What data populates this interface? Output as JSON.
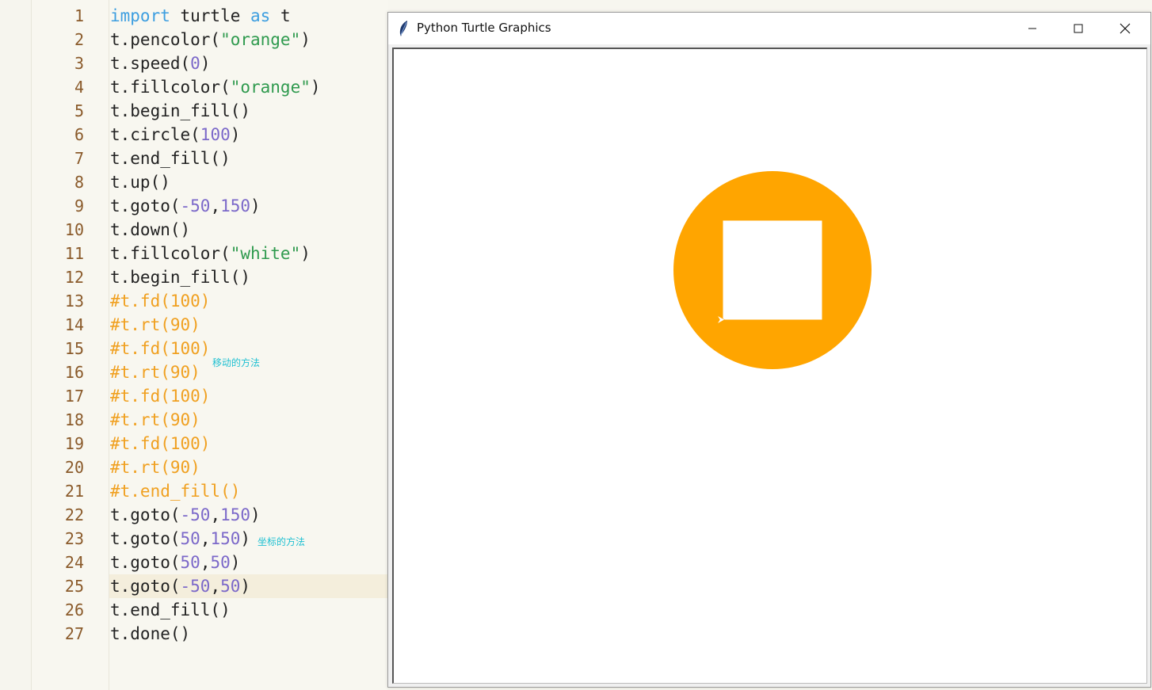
{
  "editor": {
    "lines": [
      {
        "n": "1",
        "tokens": [
          [
            "kw",
            "import"
          ],
          [
            "t",
            " turtle "
          ],
          [
            "kw",
            "as"
          ],
          [
            "t",
            " t"
          ]
        ]
      },
      {
        "n": "2",
        "tokens": [
          [
            "t",
            "t.pencolor("
          ],
          [
            "str",
            "\"orange\""
          ],
          [
            "t",
            ")"
          ]
        ]
      },
      {
        "n": "3",
        "tokens": [
          [
            "t",
            "t.speed("
          ],
          [
            "num",
            "0"
          ],
          [
            "t",
            ")"
          ]
        ]
      },
      {
        "n": "4",
        "tokens": [
          [
            "t",
            "t.fillcolor("
          ],
          [
            "str",
            "\"orange\""
          ],
          [
            "t",
            ")"
          ]
        ]
      },
      {
        "n": "5",
        "tokens": [
          [
            "t",
            "t.begin_fill()"
          ]
        ]
      },
      {
        "n": "6",
        "tokens": [
          [
            "t",
            "t.circle("
          ],
          [
            "num",
            "100"
          ],
          [
            "t",
            ")"
          ]
        ]
      },
      {
        "n": "7",
        "tokens": [
          [
            "t",
            "t.end_fill()"
          ]
        ]
      },
      {
        "n": "8",
        "tokens": [
          [
            "t",
            "t.up()"
          ]
        ]
      },
      {
        "n": "9",
        "tokens": [
          [
            "t",
            "t.goto("
          ],
          [
            "num",
            "-50"
          ],
          [
            "t",
            ","
          ],
          [
            "num",
            "150"
          ],
          [
            "t",
            ")"
          ]
        ]
      },
      {
        "n": "10",
        "tokens": [
          [
            "t",
            "t.down()"
          ]
        ]
      },
      {
        "n": "11",
        "tokens": [
          [
            "t",
            "t.fillcolor("
          ],
          [
            "str",
            "\"white\""
          ],
          [
            "t",
            ")"
          ]
        ]
      },
      {
        "n": "12",
        "tokens": [
          [
            "t",
            "t.begin_fill()"
          ]
        ]
      },
      {
        "n": "13",
        "tokens": [
          [
            "cmt",
            "#t.fd(100)"
          ]
        ]
      },
      {
        "n": "14",
        "tokens": [
          [
            "cmt",
            "#t.rt(90)"
          ]
        ]
      },
      {
        "n": "15",
        "tokens": [
          [
            "cmt",
            "#t.fd(100)"
          ]
        ]
      },
      {
        "n": "16",
        "tokens": [
          [
            "cmt",
            "#t.rt(90)"
          ]
        ]
      },
      {
        "n": "17",
        "tokens": [
          [
            "cmt",
            "#t.fd(100)"
          ]
        ]
      },
      {
        "n": "18",
        "tokens": [
          [
            "cmt",
            "#t.rt(90)"
          ]
        ]
      },
      {
        "n": "19",
        "tokens": [
          [
            "cmt",
            "#t.fd(100)"
          ]
        ]
      },
      {
        "n": "20",
        "tokens": [
          [
            "cmt",
            "#t.rt(90)"
          ]
        ]
      },
      {
        "n": "21",
        "tokens": [
          [
            "cmt",
            "#t.end_fill()"
          ]
        ]
      },
      {
        "n": "22",
        "tokens": [
          [
            "t",
            "t.goto("
          ],
          [
            "num",
            "-50"
          ],
          [
            "t",
            ","
          ],
          [
            "num",
            "150"
          ],
          [
            "t",
            ")"
          ]
        ]
      },
      {
        "n": "23",
        "tokens": [
          [
            "t",
            "t.goto("
          ],
          [
            "num",
            "50"
          ],
          [
            "t",
            ","
          ],
          [
            "num",
            "150"
          ],
          [
            "t",
            ")"
          ]
        ]
      },
      {
        "n": "24",
        "tokens": [
          [
            "t",
            "t.goto("
          ],
          [
            "num",
            "50"
          ],
          [
            "t",
            ","
          ],
          [
            "num",
            "50"
          ],
          [
            "t",
            ")"
          ]
        ]
      },
      {
        "n": "25",
        "tokens": [
          [
            "t",
            "t.goto("
          ],
          [
            "num",
            "-50"
          ],
          [
            "t",
            ","
          ],
          [
            "num",
            "50"
          ],
          [
            "t",
            ")"
          ]
        ],
        "current": true
      },
      {
        "n": "26",
        "tokens": [
          [
            "t",
            "t.end_fill()"
          ]
        ]
      },
      {
        "n": "27",
        "tokens": [
          [
            "t",
            "t.done()"
          ]
        ]
      }
    ],
    "annotation_move": "移动的方法",
    "annotation_coord": "坐标的方法"
  },
  "window": {
    "title": "Python Turtle Graphics",
    "icon": "feather-icon",
    "buttons": [
      "minimize-icon",
      "maximize-icon",
      "close-icon"
    ]
  },
  "drawing": {
    "circle_color": "#ffa500",
    "square_color": "#ffffff",
    "circle_radius": 100,
    "square": {
      "x_min": -50,
      "x_max": 50,
      "y_min": 50,
      "y_max": 150
    }
  }
}
